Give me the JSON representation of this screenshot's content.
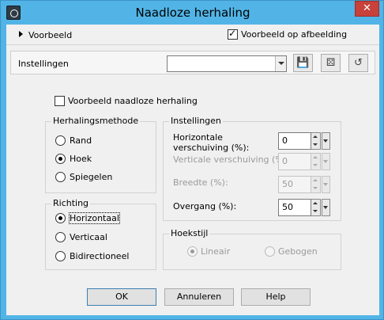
{
  "window": {
    "title": "Naadloze herhaling",
    "close_glyph": "✕"
  },
  "preview_row": {
    "label": "Voorbeeld",
    "preview_on_image_label": "Voorbeeld op afbeelding",
    "preview_on_image_checked": true
  },
  "settings_row": {
    "label": "Instellingen",
    "preset_value": "",
    "tools": [
      {
        "name": "save-preset-icon",
        "glyph": "💾"
      },
      {
        "name": "randomize-icon",
        "glyph": "⚄"
      },
      {
        "name": "reset-icon",
        "glyph": "↺"
      }
    ]
  },
  "options": {
    "preview_seamless_label": "Voorbeeld naadloze herhaling",
    "preview_seamless_checked": false
  },
  "tiling_method": {
    "title": "Herhalingsmethode",
    "options": [
      {
        "label": "Rand",
        "selected": false
      },
      {
        "label": "Hoek",
        "selected": true
      },
      {
        "label": "Spiegelen",
        "selected": false
      }
    ]
  },
  "direction": {
    "title": "Richting",
    "options": [
      {
        "label": "Horizontaal",
        "selected": true
      },
      {
        "label": "Verticaal",
        "selected": false
      },
      {
        "label": "Bidirectioneel",
        "selected": false
      }
    ]
  },
  "settings_group": {
    "title": "Instellingen",
    "fields": [
      {
        "label": "Horizontale verschuiving (%):",
        "value": "0",
        "enabled": true
      },
      {
        "label": "Verticale verschuiving (%):",
        "value": "0",
        "enabled": false
      },
      {
        "label": "Breedte (%):",
        "value": "50",
        "enabled": false
      },
      {
        "label": "Overgang (%):",
        "value": "50",
        "enabled": true
      }
    ]
  },
  "corner_style": {
    "title": "Hoekstijl",
    "options": [
      {
        "label": "Lineair",
        "selected": true,
        "enabled": false
      },
      {
        "label": "Gebogen",
        "selected": false,
        "enabled": false
      }
    ]
  },
  "buttons": {
    "ok": "OK",
    "cancel": "Annuleren",
    "help": "Help"
  },
  "colors": {
    "frame": "#52b4e6",
    "close": "#c8413a",
    "client": "#f0f0f0"
  }
}
